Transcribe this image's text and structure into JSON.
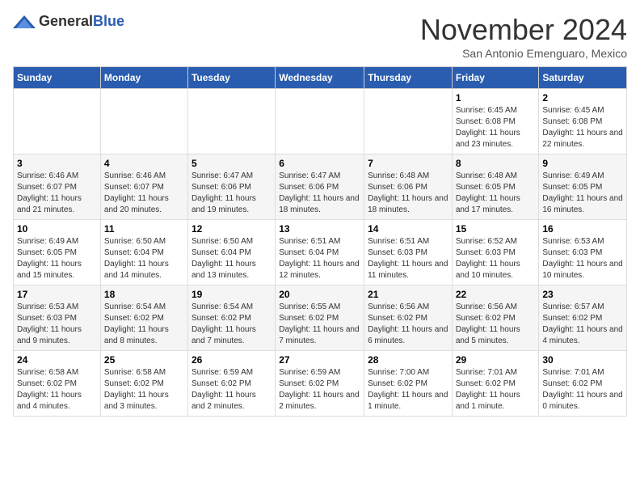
{
  "header": {
    "logo_general": "General",
    "logo_blue": "Blue",
    "month_title": "November 2024",
    "subtitle": "San Antonio Emenguaro, Mexico"
  },
  "weekdays": [
    "Sunday",
    "Monday",
    "Tuesday",
    "Wednesday",
    "Thursday",
    "Friday",
    "Saturday"
  ],
  "weeks": [
    [
      {
        "day": "",
        "info": ""
      },
      {
        "day": "",
        "info": ""
      },
      {
        "day": "",
        "info": ""
      },
      {
        "day": "",
        "info": ""
      },
      {
        "day": "",
        "info": ""
      },
      {
        "day": "1",
        "info": "Sunrise: 6:45 AM\nSunset: 6:08 PM\nDaylight: 11 hours and 23 minutes."
      },
      {
        "day": "2",
        "info": "Sunrise: 6:45 AM\nSunset: 6:08 PM\nDaylight: 11 hours and 22 minutes."
      }
    ],
    [
      {
        "day": "3",
        "info": "Sunrise: 6:46 AM\nSunset: 6:07 PM\nDaylight: 11 hours and 21 minutes."
      },
      {
        "day": "4",
        "info": "Sunrise: 6:46 AM\nSunset: 6:07 PM\nDaylight: 11 hours and 20 minutes."
      },
      {
        "day": "5",
        "info": "Sunrise: 6:47 AM\nSunset: 6:06 PM\nDaylight: 11 hours and 19 minutes."
      },
      {
        "day": "6",
        "info": "Sunrise: 6:47 AM\nSunset: 6:06 PM\nDaylight: 11 hours and 18 minutes."
      },
      {
        "day": "7",
        "info": "Sunrise: 6:48 AM\nSunset: 6:06 PM\nDaylight: 11 hours and 18 minutes."
      },
      {
        "day": "8",
        "info": "Sunrise: 6:48 AM\nSunset: 6:05 PM\nDaylight: 11 hours and 17 minutes."
      },
      {
        "day": "9",
        "info": "Sunrise: 6:49 AM\nSunset: 6:05 PM\nDaylight: 11 hours and 16 minutes."
      }
    ],
    [
      {
        "day": "10",
        "info": "Sunrise: 6:49 AM\nSunset: 6:05 PM\nDaylight: 11 hours and 15 minutes."
      },
      {
        "day": "11",
        "info": "Sunrise: 6:50 AM\nSunset: 6:04 PM\nDaylight: 11 hours and 14 minutes."
      },
      {
        "day": "12",
        "info": "Sunrise: 6:50 AM\nSunset: 6:04 PM\nDaylight: 11 hours and 13 minutes."
      },
      {
        "day": "13",
        "info": "Sunrise: 6:51 AM\nSunset: 6:04 PM\nDaylight: 11 hours and 12 minutes."
      },
      {
        "day": "14",
        "info": "Sunrise: 6:51 AM\nSunset: 6:03 PM\nDaylight: 11 hours and 11 minutes."
      },
      {
        "day": "15",
        "info": "Sunrise: 6:52 AM\nSunset: 6:03 PM\nDaylight: 11 hours and 10 minutes."
      },
      {
        "day": "16",
        "info": "Sunrise: 6:53 AM\nSunset: 6:03 PM\nDaylight: 11 hours and 10 minutes."
      }
    ],
    [
      {
        "day": "17",
        "info": "Sunrise: 6:53 AM\nSunset: 6:03 PM\nDaylight: 11 hours and 9 minutes."
      },
      {
        "day": "18",
        "info": "Sunrise: 6:54 AM\nSunset: 6:02 PM\nDaylight: 11 hours and 8 minutes."
      },
      {
        "day": "19",
        "info": "Sunrise: 6:54 AM\nSunset: 6:02 PM\nDaylight: 11 hours and 7 minutes."
      },
      {
        "day": "20",
        "info": "Sunrise: 6:55 AM\nSunset: 6:02 PM\nDaylight: 11 hours and 7 minutes."
      },
      {
        "day": "21",
        "info": "Sunrise: 6:56 AM\nSunset: 6:02 PM\nDaylight: 11 hours and 6 minutes."
      },
      {
        "day": "22",
        "info": "Sunrise: 6:56 AM\nSunset: 6:02 PM\nDaylight: 11 hours and 5 minutes."
      },
      {
        "day": "23",
        "info": "Sunrise: 6:57 AM\nSunset: 6:02 PM\nDaylight: 11 hours and 4 minutes."
      }
    ],
    [
      {
        "day": "24",
        "info": "Sunrise: 6:58 AM\nSunset: 6:02 PM\nDaylight: 11 hours and 4 minutes."
      },
      {
        "day": "25",
        "info": "Sunrise: 6:58 AM\nSunset: 6:02 PM\nDaylight: 11 hours and 3 minutes."
      },
      {
        "day": "26",
        "info": "Sunrise: 6:59 AM\nSunset: 6:02 PM\nDaylight: 11 hours and 2 minutes."
      },
      {
        "day": "27",
        "info": "Sunrise: 6:59 AM\nSunset: 6:02 PM\nDaylight: 11 hours and 2 minutes."
      },
      {
        "day": "28",
        "info": "Sunrise: 7:00 AM\nSunset: 6:02 PM\nDaylight: 11 hours and 1 minute."
      },
      {
        "day": "29",
        "info": "Sunrise: 7:01 AM\nSunset: 6:02 PM\nDaylight: 11 hours and 1 minute."
      },
      {
        "day": "30",
        "info": "Sunrise: 7:01 AM\nSunset: 6:02 PM\nDaylight: 11 hours and 0 minutes."
      }
    ]
  ]
}
